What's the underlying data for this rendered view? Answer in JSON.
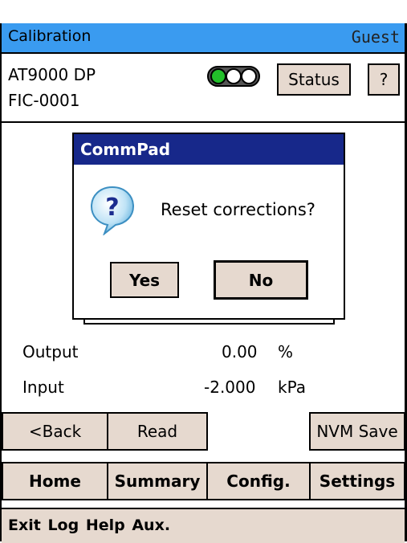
{
  "titlebar": {
    "app": "Calibration",
    "user": "Guest"
  },
  "device": {
    "model": "AT9000 DP",
    "tag": "FIC-0001",
    "status_button": "Status",
    "help_button": "?"
  },
  "dialog": {
    "title": "CommPad",
    "message": "Reset corrections?",
    "yes_label": "Yes",
    "no_label": "No",
    "icon": "question-icon"
  },
  "readings": [
    {
      "label": "Output",
      "value": "0.00",
      "unit": "%"
    },
    {
      "label": "Input",
      "value": "-2.000",
      "unit": "kPa"
    }
  ],
  "actions": {
    "back": "<Back",
    "read": "Read",
    "nvm_save": "NVM Save"
  },
  "nav": {
    "home": "Home",
    "summary": "Summary",
    "config": "Config.",
    "settings": "Settings"
  },
  "footer": {
    "menu": "Exit Log Help Aux."
  },
  "colors": {
    "titlebar": "#3a9bf0",
    "dialog_title": "#17288a",
    "button": "#e6d9cf",
    "light_active": "#22c02a"
  }
}
